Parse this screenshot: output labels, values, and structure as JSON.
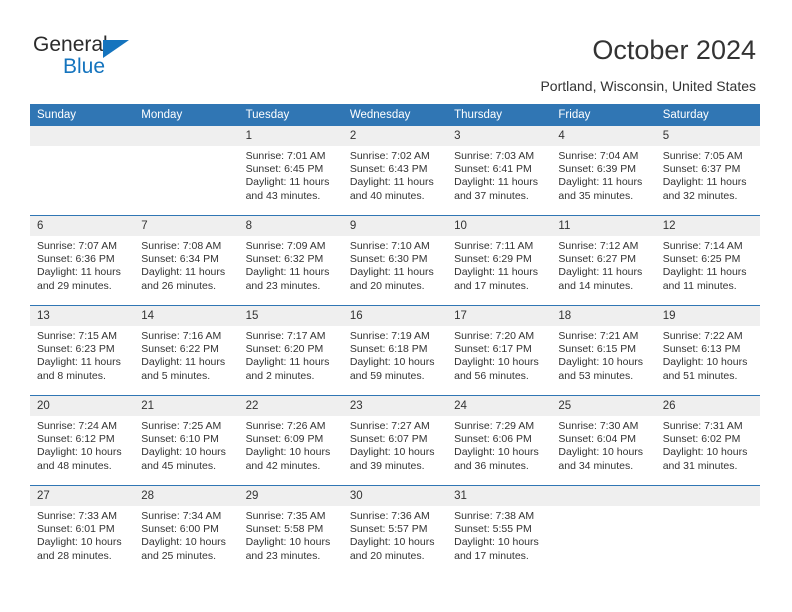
{
  "logo": {
    "text_primary": "General",
    "text_secondary": "Blue",
    "primary_color": "#2b2b2b",
    "accent_color": "#1574BE"
  },
  "header": {
    "title": "October 2024",
    "subtitle": "Portland, Wisconsin, United States"
  },
  "colors": {
    "header_blue": "#3076B4",
    "daynum_band": "#EFEFEF",
    "text": "#333333",
    "cell_background": "#FFFFFF"
  },
  "weekdays": [
    "Sunday",
    "Monday",
    "Tuesday",
    "Wednesday",
    "Thursday",
    "Friday",
    "Saturday"
  ],
  "labels": {
    "sunrise_prefix": "Sunrise:",
    "sunset_prefix": "Sunset:",
    "daylight_prefix": "Daylight:"
  },
  "weeks": [
    [
      {
        "day": "",
        "empty": true
      },
      {
        "day": "",
        "empty": true
      },
      {
        "day": "1",
        "sunrise": "Sunrise: 7:01 AM",
        "sunset": "Sunset: 6:45 PM",
        "daylight_1": "Daylight: 11 hours",
        "daylight_2": "and 43 minutes."
      },
      {
        "day": "2",
        "sunrise": "Sunrise: 7:02 AM",
        "sunset": "Sunset: 6:43 PM",
        "daylight_1": "Daylight: 11 hours",
        "daylight_2": "and 40 minutes."
      },
      {
        "day": "3",
        "sunrise": "Sunrise: 7:03 AM",
        "sunset": "Sunset: 6:41 PM",
        "daylight_1": "Daylight: 11 hours",
        "daylight_2": "and 37 minutes."
      },
      {
        "day": "4",
        "sunrise": "Sunrise: 7:04 AM",
        "sunset": "Sunset: 6:39 PM",
        "daylight_1": "Daylight: 11 hours",
        "daylight_2": "and 35 minutes."
      },
      {
        "day": "5",
        "sunrise": "Sunrise: 7:05 AM",
        "sunset": "Sunset: 6:37 PM",
        "daylight_1": "Daylight: 11 hours",
        "daylight_2": "and 32 minutes."
      }
    ],
    [
      {
        "day": "6",
        "sunrise": "Sunrise: 7:07 AM",
        "sunset": "Sunset: 6:36 PM",
        "daylight_1": "Daylight: 11 hours",
        "daylight_2": "and 29 minutes."
      },
      {
        "day": "7",
        "sunrise": "Sunrise: 7:08 AM",
        "sunset": "Sunset: 6:34 PM",
        "daylight_1": "Daylight: 11 hours",
        "daylight_2": "and 26 minutes."
      },
      {
        "day": "8",
        "sunrise": "Sunrise: 7:09 AM",
        "sunset": "Sunset: 6:32 PM",
        "daylight_1": "Daylight: 11 hours",
        "daylight_2": "and 23 minutes."
      },
      {
        "day": "9",
        "sunrise": "Sunrise: 7:10 AM",
        "sunset": "Sunset: 6:30 PM",
        "daylight_1": "Daylight: 11 hours",
        "daylight_2": "and 20 minutes."
      },
      {
        "day": "10",
        "sunrise": "Sunrise: 7:11 AM",
        "sunset": "Sunset: 6:29 PM",
        "daylight_1": "Daylight: 11 hours",
        "daylight_2": "and 17 minutes."
      },
      {
        "day": "11",
        "sunrise": "Sunrise: 7:12 AM",
        "sunset": "Sunset: 6:27 PM",
        "daylight_1": "Daylight: 11 hours",
        "daylight_2": "and 14 minutes."
      },
      {
        "day": "12",
        "sunrise": "Sunrise: 7:14 AM",
        "sunset": "Sunset: 6:25 PM",
        "daylight_1": "Daylight: 11 hours",
        "daylight_2": "and 11 minutes."
      }
    ],
    [
      {
        "day": "13",
        "sunrise": "Sunrise: 7:15 AM",
        "sunset": "Sunset: 6:23 PM",
        "daylight_1": "Daylight: 11 hours",
        "daylight_2": "and 8 minutes."
      },
      {
        "day": "14",
        "sunrise": "Sunrise: 7:16 AM",
        "sunset": "Sunset: 6:22 PM",
        "daylight_1": "Daylight: 11 hours",
        "daylight_2": "and 5 minutes."
      },
      {
        "day": "15",
        "sunrise": "Sunrise: 7:17 AM",
        "sunset": "Sunset: 6:20 PM",
        "daylight_1": "Daylight: 11 hours",
        "daylight_2": "and 2 minutes."
      },
      {
        "day": "16",
        "sunrise": "Sunrise: 7:19 AM",
        "sunset": "Sunset: 6:18 PM",
        "daylight_1": "Daylight: 10 hours",
        "daylight_2": "and 59 minutes."
      },
      {
        "day": "17",
        "sunrise": "Sunrise: 7:20 AM",
        "sunset": "Sunset: 6:17 PM",
        "daylight_1": "Daylight: 10 hours",
        "daylight_2": "and 56 minutes."
      },
      {
        "day": "18",
        "sunrise": "Sunrise: 7:21 AM",
        "sunset": "Sunset: 6:15 PM",
        "daylight_1": "Daylight: 10 hours",
        "daylight_2": "and 53 minutes."
      },
      {
        "day": "19",
        "sunrise": "Sunrise: 7:22 AM",
        "sunset": "Sunset: 6:13 PM",
        "daylight_1": "Daylight: 10 hours",
        "daylight_2": "and 51 minutes."
      }
    ],
    [
      {
        "day": "20",
        "sunrise": "Sunrise: 7:24 AM",
        "sunset": "Sunset: 6:12 PM",
        "daylight_1": "Daylight: 10 hours",
        "daylight_2": "and 48 minutes."
      },
      {
        "day": "21",
        "sunrise": "Sunrise: 7:25 AM",
        "sunset": "Sunset: 6:10 PM",
        "daylight_1": "Daylight: 10 hours",
        "daylight_2": "and 45 minutes."
      },
      {
        "day": "22",
        "sunrise": "Sunrise: 7:26 AM",
        "sunset": "Sunset: 6:09 PM",
        "daylight_1": "Daylight: 10 hours",
        "daylight_2": "and 42 minutes."
      },
      {
        "day": "23",
        "sunrise": "Sunrise: 7:27 AM",
        "sunset": "Sunset: 6:07 PM",
        "daylight_1": "Daylight: 10 hours",
        "daylight_2": "and 39 minutes."
      },
      {
        "day": "24",
        "sunrise": "Sunrise: 7:29 AM",
        "sunset": "Sunset: 6:06 PM",
        "daylight_1": "Daylight: 10 hours",
        "daylight_2": "and 36 minutes."
      },
      {
        "day": "25",
        "sunrise": "Sunrise: 7:30 AM",
        "sunset": "Sunset: 6:04 PM",
        "daylight_1": "Daylight: 10 hours",
        "daylight_2": "and 34 minutes."
      },
      {
        "day": "26",
        "sunrise": "Sunrise: 7:31 AM",
        "sunset": "Sunset: 6:02 PM",
        "daylight_1": "Daylight: 10 hours",
        "daylight_2": "and 31 minutes."
      }
    ],
    [
      {
        "day": "27",
        "sunrise": "Sunrise: 7:33 AM",
        "sunset": "Sunset: 6:01 PM",
        "daylight_1": "Daylight: 10 hours",
        "daylight_2": "and 28 minutes."
      },
      {
        "day": "28",
        "sunrise": "Sunrise: 7:34 AM",
        "sunset": "Sunset: 6:00 PM",
        "daylight_1": "Daylight: 10 hours",
        "daylight_2": "and 25 minutes."
      },
      {
        "day": "29",
        "sunrise": "Sunrise: 7:35 AM",
        "sunset": "Sunset: 5:58 PM",
        "daylight_1": "Daylight: 10 hours",
        "daylight_2": "and 23 minutes."
      },
      {
        "day": "30",
        "sunrise": "Sunrise: 7:36 AM",
        "sunset": "Sunset: 5:57 PM",
        "daylight_1": "Daylight: 10 hours",
        "daylight_2": "and 20 minutes."
      },
      {
        "day": "31",
        "sunrise": "Sunrise: 7:38 AM",
        "sunset": "Sunset: 5:55 PM",
        "daylight_1": "Daylight: 10 hours",
        "daylight_2": "and 17 minutes."
      },
      {
        "day": "",
        "empty": true
      },
      {
        "day": "",
        "empty": true
      }
    ]
  ]
}
